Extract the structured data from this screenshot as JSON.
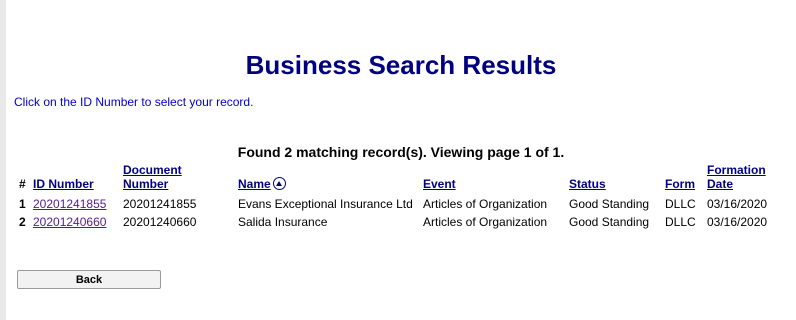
{
  "header": {
    "title": "Business Search Results",
    "instructions": "Click on the ID Number to select your record."
  },
  "summary": "Found 2 matching record(s).  Viewing page 1 of 1.",
  "table": {
    "columns": {
      "num": "#",
      "id_number": "ID Number",
      "document_number": "Document Number",
      "name": "Name",
      "event": "Event",
      "status": "Status",
      "form": "Form",
      "formation_date": "Formation Date"
    },
    "sort_icon": "sort-ascending-icon",
    "rows": [
      {
        "num": "1",
        "id_number": "20201241855",
        "document_number": "20201241855",
        "name": "Evans Exceptional Insurance Ltd",
        "event": "Articles of Organization",
        "status": "Good Standing",
        "form": "DLLC",
        "formation_date": "03/16/2020"
      },
      {
        "num": "2",
        "id_number": "20201240660",
        "document_number": "20201240660",
        "name": "Salida Insurance",
        "event": "Articles of Organization",
        "status": "Good Standing",
        "form": "DLLC",
        "formation_date": "03/16/2020"
      }
    ]
  },
  "buttons": {
    "back": "Back"
  },
  "colors": {
    "title": "#000080",
    "instructions": "#0000cc",
    "visited_link": "#551a8b"
  }
}
